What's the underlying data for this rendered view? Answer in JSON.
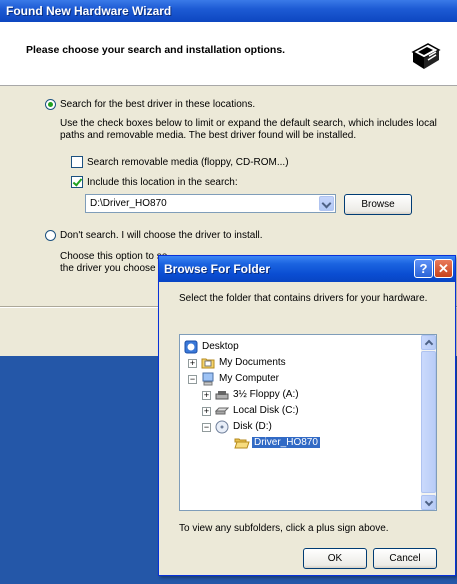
{
  "wizard": {
    "title": "Found New Hardware Wizard",
    "heading": "Please choose your search and installation options.",
    "option_search": {
      "label": "Search for the best driver in these locations.",
      "selected": true,
      "description_line1": "Use the check boxes below to limit or expand the default search, which includes local",
      "description_line2": "paths and removable media. The best driver found will be installed."
    },
    "check_removable": {
      "label": "Search removable media (floppy, CD-ROM...)",
      "checked": false
    },
    "check_include": {
      "label": "Include this location in the search:",
      "checked": true
    },
    "location_value": "D:\\Driver_HO870",
    "browse_label": "Browse",
    "option_dont_search": {
      "label": "Don't search. I will choose the driver to install.",
      "selected": false,
      "description_line1": "Choose this option to se",
      "description_line2": "the driver you choose w"
    }
  },
  "browse_dialog": {
    "title": "Browse For Folder",
    "help_glyph": "?",
    "close_glyph": "✕",
    "instruction": "Select the folder that contains drivers for your hardware.",
    "tree": [
      {
        "label": "Desktop",
        "icon": "desktop-icon"
      },
      {
        "label": "My Documents",
        "icon": "folder-icon",
        "expander": "+"
      },
      {
        "label": "My Computer",
        "icon": "computer-icon",
        "expander": "−"
      },
      {
        "label": "3½ Floppy (A:)",
        "icon": "floppy-icon",
        "expander": "+"
      },
      {
        "label": "Local Disk (C:)",
        "icon": "hard-disk-icon",
        "expander": "+"
      },
      {
        "label": "Disk (D:)",
        "icon": "cd-drive-icon",
        "expander": "−"
      },
      {
        "label": "Driver_HO870",
        "icon": "open-folder-icon",
        "selected": true
      }
    ],
    "hint": "To view any subfolders, click a plus sign above.",
    "ok_label": "OK",
    "cancel_label": "Cancel"
  },
  "colors": {
    "titlebar_blue": "#0a4dd2",
    "desktop_blue": "#2457a8",
    "selection_blue": "#316ac5",
    "check_green": "#21a121",
    "close_red": "#c8421b"
  }
}
